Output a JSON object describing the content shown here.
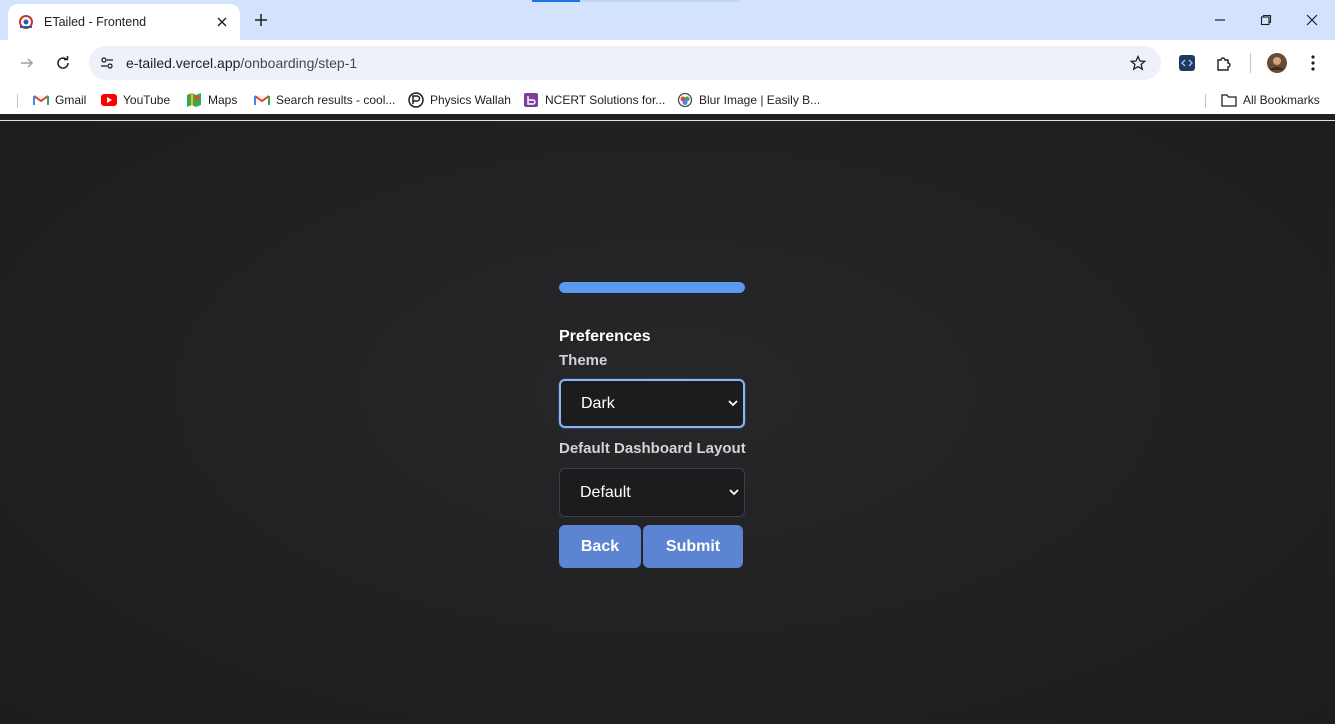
{
  "browser": {
    "tab": {
      "title": "ETailed - Frontend",
      "favicon": "etailed-logo-icon"
    },
    "window_controls": [
      "minimize-icon",
      "restore-icon",
      "close-icon"
    ],
    "url": {
      "host": "e-tailed.vercel.app",
      "path": "/onboarding/step-1"
    },
    "bookmarks": [
      {
        "label": "Gmail",
        "icon": "gmail-icon"
      },
      {
        "label": "YouTube",
        "icon": "youtube-icon"
      },
      {
        "label": "Maps",
        "icon": "maps-icon"
      },
      {
        "label": "Search results - cool...",
        "icon": "gmail-icon"
      },
      {
        "label": "Physics Wallah",
        "icon": "physics-wallah-icon"
      },
      {
        "label": "NCERT Solutions for...",
        "icon": "ncert-icon"
      },
      {
        "label": "Blur Image | Easily B...",
        "icon": "blur-image-icon"
      }
    ],
    "all_bookmarks_label": "All Bookmarks"
  },
  "onboarding": {
    "progress": 1.0,
    "progress_color": "#5a9bf0",
    "section_title": "Preferences",
    "theme": {
      "label": "Theme",
      "value": "Dark"
    },
    "layout": {
      "label": "Default Dashboard Layout",
      "value": "Default"
    },
    "back_label": "Back",
    "submit_label": "Submit",
    "button_color": "#5c84d2"
  }
}
